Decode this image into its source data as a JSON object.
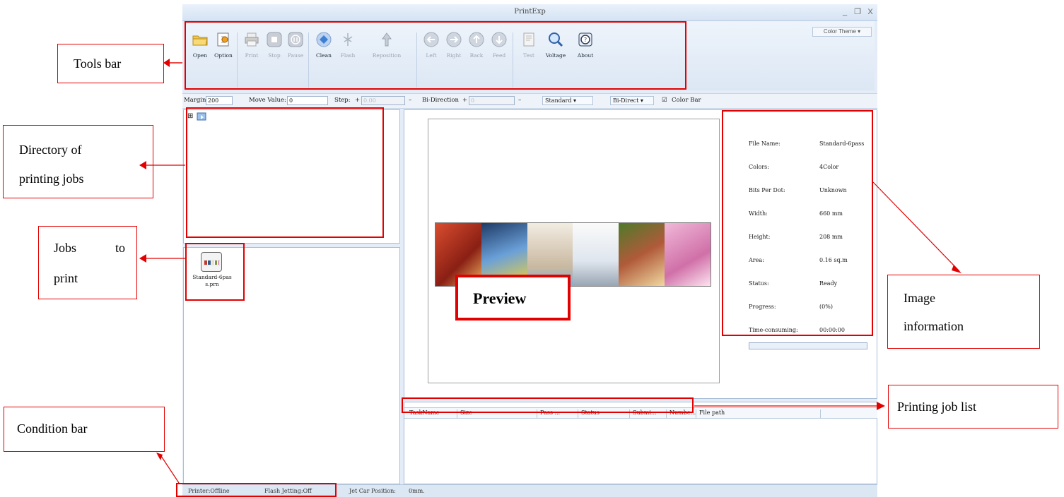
{
  "window": {
    "title": "PrintExp",
    "controls": [
      "_",
      "❐",
      "X"
    ],
    "color_theme": "Color Theme ▾"
  },
  "toolbar": {
    "buttons": [
      {
        "label": "Open",
        "icon": "folder-icon",
        "enabled": true
      },
      {
        "label": "Option",
        "icon": "options-icon",
        "enabled": true
      },
      {
        "label": "Print",
        "icon": "printer-icon",
        "enabled": false
      },
      {
        "label": "Stop",
        "icon": "stop-icon",
        "enabled": false
      },
      {
        "label": "Pause",
        "icon": "pause-icon",
        "enabled": false
      },
      {
        "label": "Clean",
        "icon": "clean-icon",
        "enabled": true
      },
      {
        "label": "Flash",
        "icon": "flash-icon",
        "enabled": false
      },
      {
        "label": "Reposition",
        "icon": "reposition-icon",
        "enabled": false
      },
      {
        "label": "Left",
        "icon": "arrow-left-icon",
        "enabled": false
      },
      {
        "label": "Right",
        "icon": "arrow-right-icon",
        "enabled": false
      },
      {
        "label": "Back",
        "icon": "arrow-up-icon",
        "enabled": false
      },
      {
        "label": "Feed",
        "icon": "arrow-down-icon",
        "enabled": false
      },
      {
        "label": "Test",
        "icon": "test-print-icon",
        "enabled": false
      },
      {
        "label": "Voltage",
        "icon": "voltage-icon",
        "enabled": true
      },
      {
        "label": "About",
        "icon": "about-icon",
        "enabled": true
      }
    ]
  },
  "options": {
    "margin_label": "Margin:",
    "margin_value": "200",
    "move_label": "Move Value:",
    "move_value": "0",
    "step_label": "Step:",
    "step_plus": "+",
    "step_value": "0.00",
    "step_minus": "–",
    "bidir_label": "Bi-Direction",
    "bidir_plus": "+",
    "bidir_value": "0",
    "bidir_minus": "–",
    "mode_select": "Standard ▾",
    "direction_select": "Bi-Direct ▾",
    "color_bar_check": "☑",
    "color_bar_label": "Color Bar"
  },
  "tree": {
    "expander": "⊞"
  },
  "jobs": [
    {
      "name": "Standard-6pass.prn",
      "name_lines": [
        "Standard-6pas",
        "s.prn"
      ]
    }
  ],
  "image_info": [
    {
      "label": "File Name:",
      "value": "Standard-6pass"
    },
    {
      "label": "Colors:",
      "value": "4Color"
    },
    {
      "label": "Bits Per Dot:",
      "value": "Unknown"
    },
    {
      "label": "Width:",
      "value": "660 mm"
    },
    {
      "label": "Height:",
      "value": "208 mm"
    },
    {
      "label": "Area:",
      "value": "0.16 sq.m"
    },
    {
      "label": "Status:",
      "value": "Ready"
    },
    {
      "label": "Progress:",
      "value": "(0%)"
    },
    {
      "label": "Time-consuming:",
      "value": "00:00:00"
    }
  ],
  "progress": 0,
  "job_list": {
    "columns": [
      "TaskName",
      "Size",
      "Pass ...",
      "Status",
      "Submi...",
      "Numbe...",
      "File path"
    ]
  },
  "status_bar": {
    "printer": "Printer:Offline",
    "flash": "Flash Jetting:Off",
    "jet_label": "Jet Car Position:",
    "jet_value": "0mm."
  },
  "annotations": {
    "tools_bar": "Tools bar",
    "directory": [
      "Directory of",
      "printing jobs"
    ],
    "jobs_to_print": [
      "Jobs",
      "to",
      "print"
    ],
    "condition_bar": "Condition bar",
    "preview": "Preview",
    "image_information": [
      "Image",
      "information"
    ],
    "printing_job_list": "Printing job list"
  },
  "colors": {
    "annotation_red": "#e30000",
    "ribbon_blue": "#dce7f4",
    "strip_segments": [
      "#c23a2c",
      "#2d5a8c",
      "#e8e0d0",
      "#f5f5f5",
      "#7a9a3a",
      "#d898c8"
    ]
  }
}
